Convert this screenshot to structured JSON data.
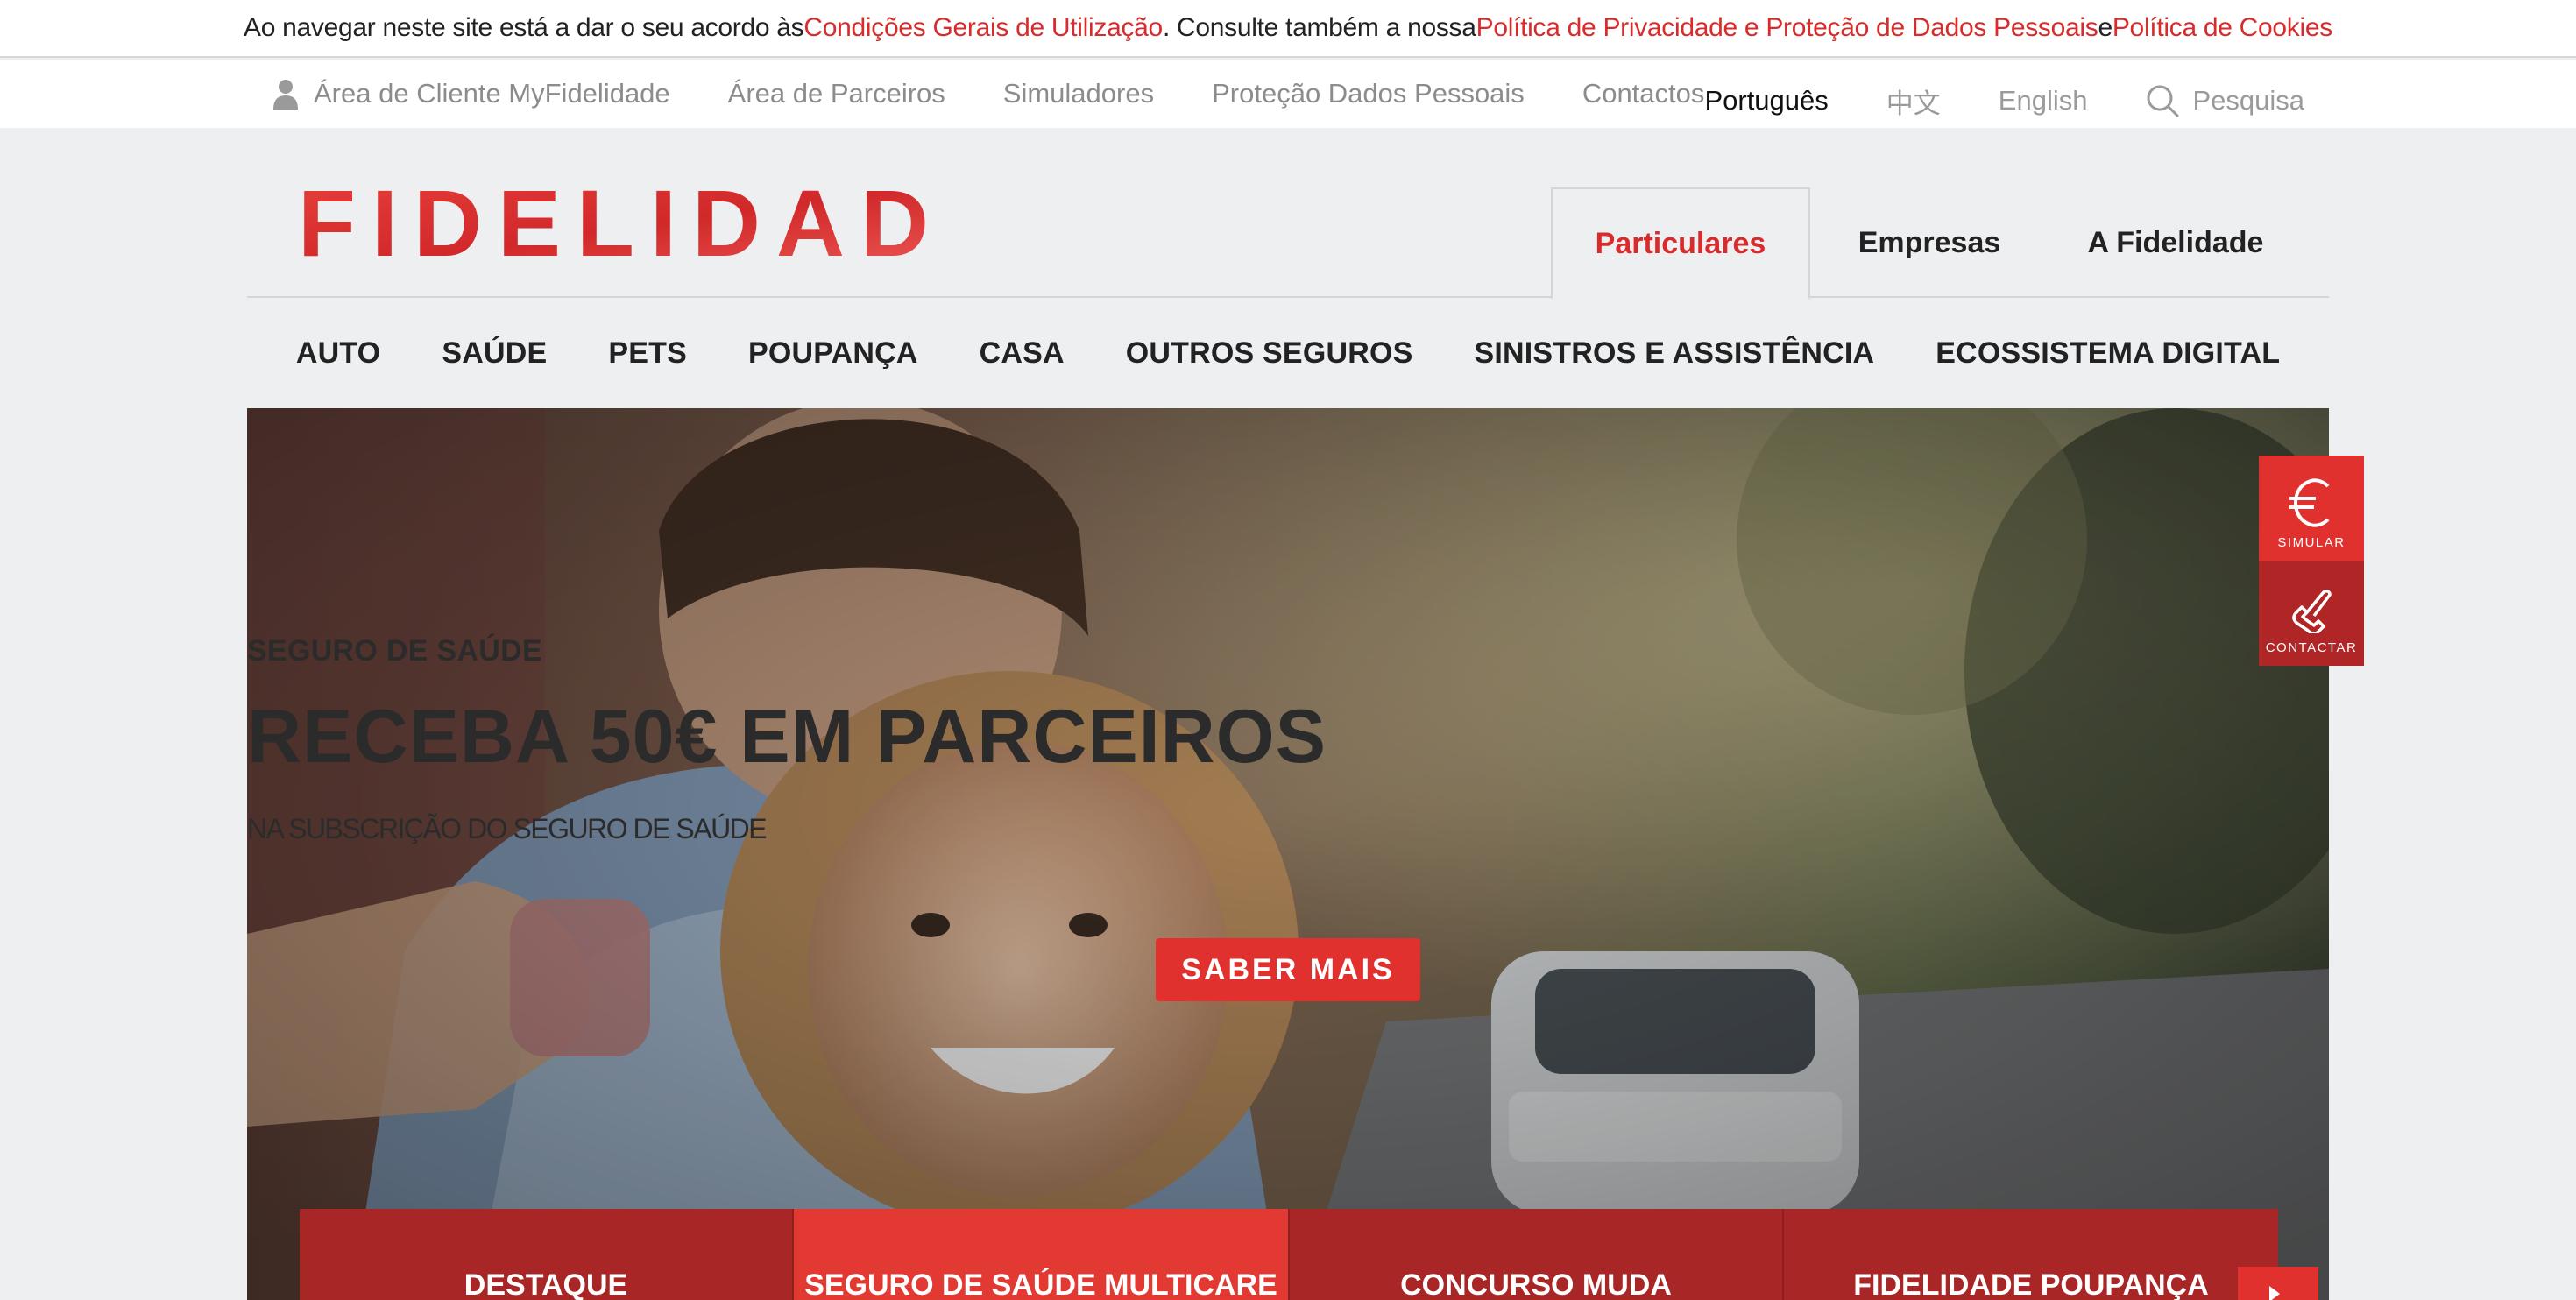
{
  "notice": {
    "part1": "Ao navegar neste site está a dar o seu acordo às ",
    "link1": "Condições Gerais de Utilização",
    "part2": ". Consulte também a nossa ",
    "link2": "Política de Privacidade e Proteção de Dados Pessoais",
    "part3": " e ",
    "link3": "Política de Cookies"
  },
  "utility": {
    "client_area": "Área de Cliente MyFidelidade",
    "partners_area": "Área de Parceiros",
    "simulators": "Simuladores",
    "data_protection": "Proteção Dados Pessoais",
    "contacts": "Contactos",
    "languages": [
      "Português",
      "中文",
      "English"
    ],
    "search": "Pesquisa"
  },
  "logo_text": "FIDELIDADE",
  "segments": [
    "Particulares",
    "Empresas",
    "A Fidelidade"
  ],
  "nav": [
    "AUTO",
    "SAÚDE",
    "PETS",
    "POUPANÇA",
    "CASA",
    "OUTROS SEGUROS",
    "SINISTROS E ASSISTÊNCIA",
    "ECOSSISTEMA DIGITAL"
  ],
  "hero": {
    "kicker": "SEGURO DE SAÚDE",
    "title": "RECEBA 50€ EM PARCEIROS",
    "subtitle": "NA SUBSCRIÇÃO DO SEGURO DE SAÚDE",
    "button": "SABER MAIS"
  },
  "tabs": [
    "DESTAQUE",
    "SEGURO DE SAÚDE MULTICARE",
    "CONCURSO MUDA",
    "FIDELIDADE POUPANÇA"
  ],
  "side": {
    "simulate": "SIMULAR",
    "contact": "CONTACTAR"
  },
  "colors": {
    "brand_red": "#e0312e",
    "dark_red": "#a82626",
    "link_red": "#d92b2b"
  }
}
